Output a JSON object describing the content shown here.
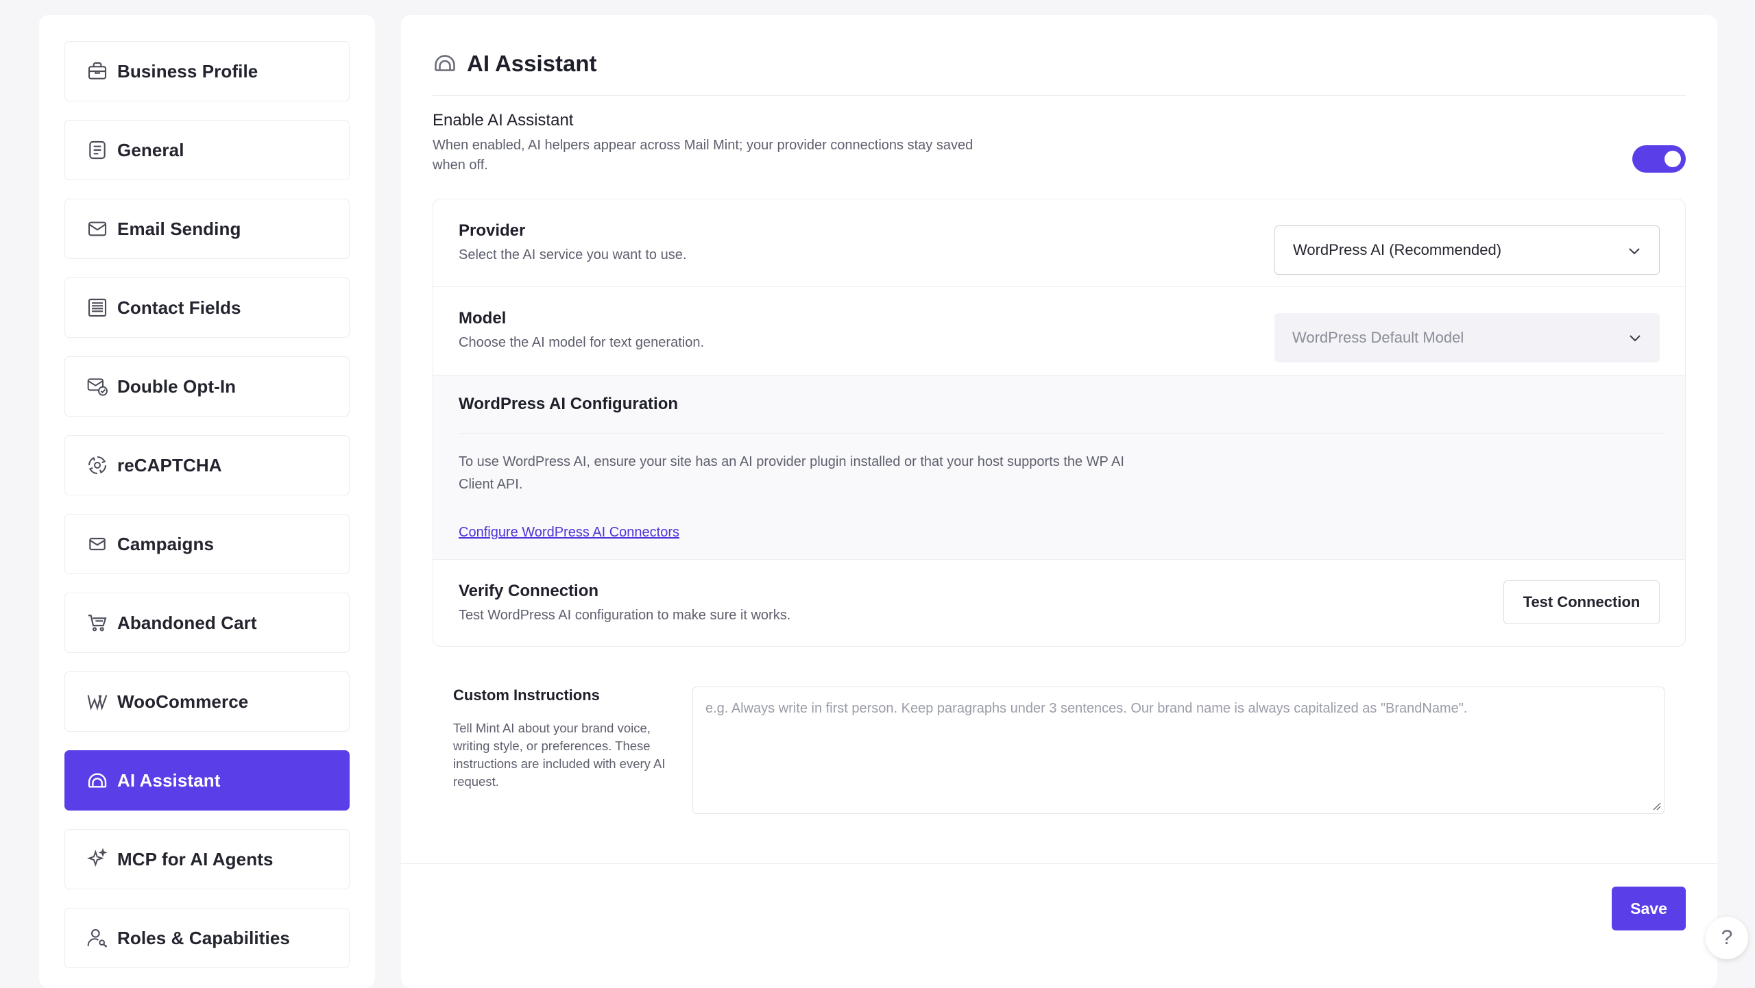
{
  "sidebar": {
    "items": [
      {
        "label": "Business Profile",
        "icon": "briefcase-icon"
      },
      {
        "label": "General",
        "icon": "document-icon"
      },
      {
        "label": "Email Sending",
        "icon": "envelope-icon"
      },
      {
        "label": "Contact Fields",
        "icon": "form-list-icon"
      },
      {
        "label": "Double Opt-In",
        "icon": "mail-check-icon"
      },
      {
        "label": "reCAPTCHA",
        "icon": "recaptcha-icon"
      },
      {
        "label": "Campaigns",
        "icon": "mail-icon"
      },
      {
        "label": "Abandoned Cart",
        "icon": "cart-icon"
      },
      {
        "label": "WooCommerce",
        "icon": "woocommerce-icon"
      },
      {
        "label": "AI Assistant",
        "icon": "ai-icon"
      },
      {
        "label": "MCP for AI Agents",
        "icon": "sparkle-icon"
      },
      {
        "label": "Roles & Capabilities",
        "icon": "user-key-icon"
      }
    ],
    "active": "AI Assistant"
  },
  "header": {
    "title": "AI Assistant"
  },
  "enable": {
    "title": "Enable AI Assistant",
    "description": "When enabled, AI helpers appear across Mail Mint; your provider connections stay saved when off.",
    "enabled": true
  },
  "provider": {
    "title": "Provider",
    "description": "Select the AI service you want to use.",
    "selected": "WordPress AI (Recommended)"
  },
  "model": {
    "title": "Model",
    "description": "Choose the AI model for text generation.",
    "selected": "WordPress Default Model"
  },
  "config": {
    "title": "WordPress AI Configuration",
    "description": "To use WordPress AI, ensure your site has an AI provider plugin installed or that your host supports the WP AI Client API.",
    "link": "Configure WordPress AI Connectors"
  },
  "verify": {
    "title": "Verify Connection",
    "description": "Test WordPress AI configuration to make sure it works.",
    "button": "Test Connection"
  },
  "custom": {
    "title": "Custom Instructions",
    "description": "Tell Mint AI about your brand voice, writing style, or preferences. These instructions are included with every AI request.",
    "placeholder": "e.g. Always write in first person. Keep paragraphs under 3 sentences. Our brand name is always capitalized as \"BrandName\"."
  },
  "footer": {
    "save": "Save"
  },
  "help": {
    "label": "?"
  },
  "colors": {
    "accent": "#5a3ee8",
    "link": "#4e32d9"
  }
}
